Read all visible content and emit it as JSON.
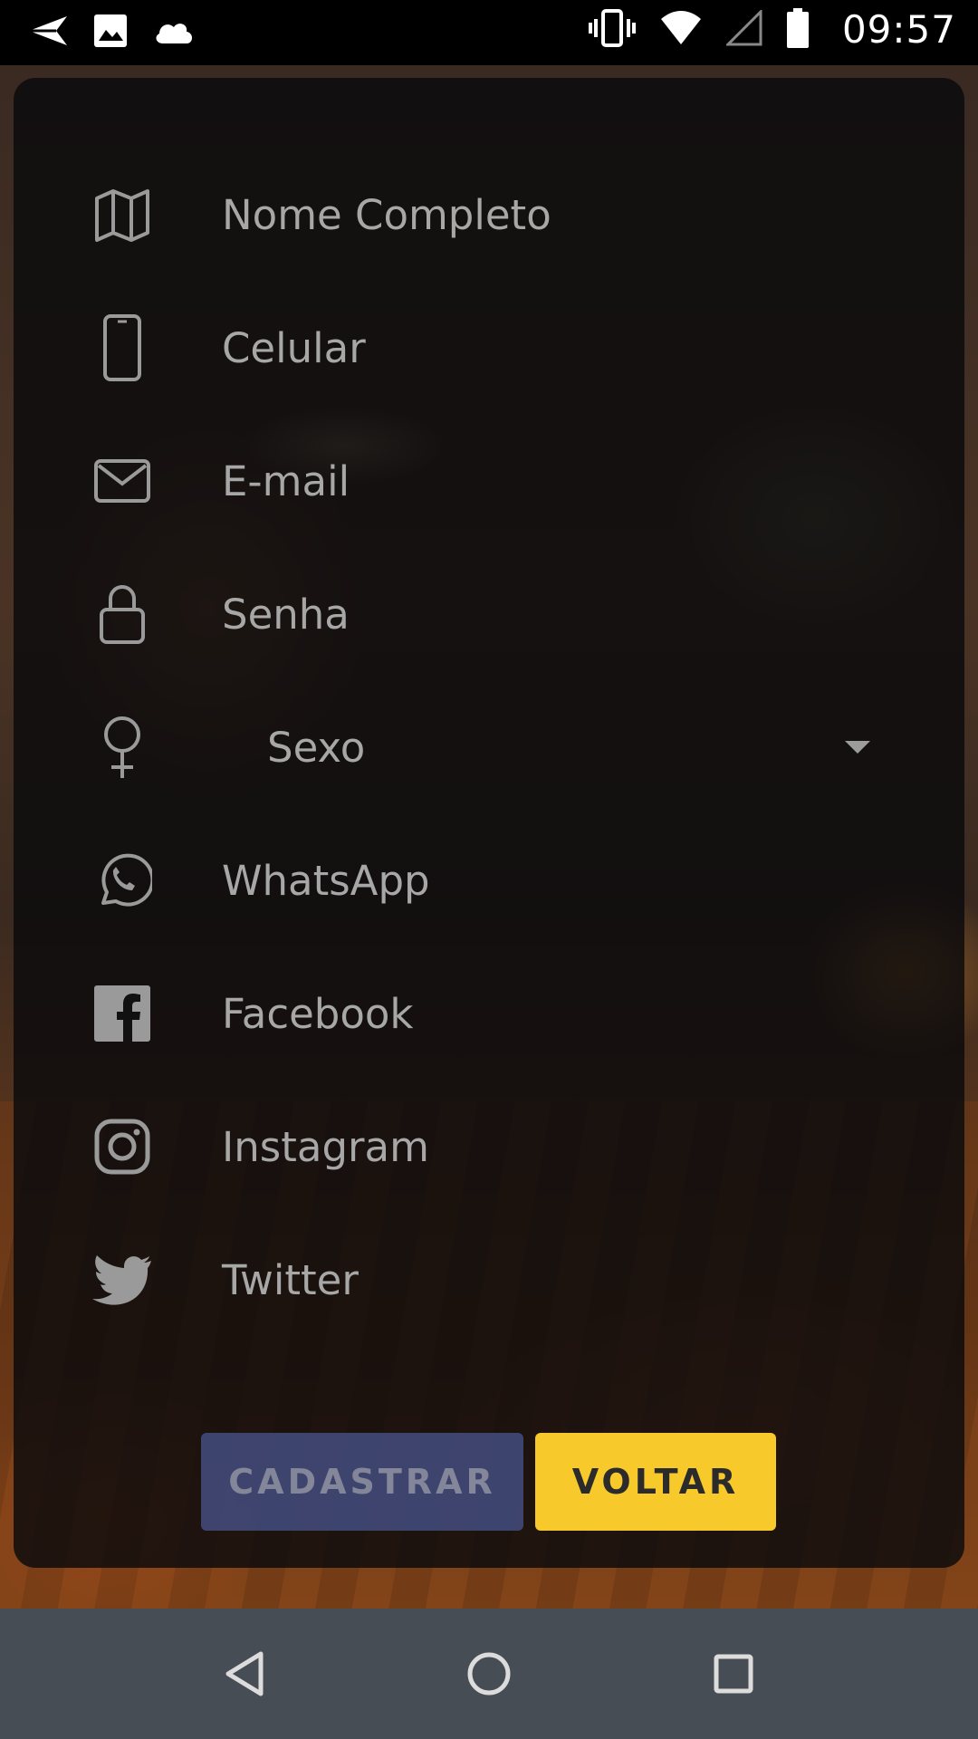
{
  "status_bar": {
    "time": "09:57",
    "icons": [
      "send-icon",
      "image-icon",
      "cloud-icon",
      "vibrate-icon",
      "wifi-icon",
      "cell-signal-icon",
      "battery-icon"
    ]
  },
  "form": {
    "fields": [
      {
        "icon": "map-icon",
        "placeholder": "Nome Completo"
      },
      {
        "icon": "phone-icon",
        "placeholder": "Celular"
      },
      {
        "icon": "email-icon",
        "placeholder": "E-mail"
      },
      {
        "icon": "lock-icon",
        "placeholder": "Senha"
      },
      {
        "icon": "female-icon",
        "placeholder": "Sexo"
      },
      {
        "icon": "whatsapp-icon",
        "placeholder": "WhatsApp"
      },
      {
        "icon": "facebook-icon",
        "placeholder": "Facebook"
      },
      {
        "icon": "instagram-icon",
        "placeholder": "Instagram"
      },
      {
        "icon": "twitter-icon",
        "placeholder": "Twitter"
      }
    ],
    "sexo_selected": "Sexo"
  },
  "buttons": {
    "cadastrar": "CADASTRAR",
    "voltar": "VOLTAR"
  },
  "colors": {
    "accent_yellow": "#f7c92b",
    "disabled_blue": "#5a6ebe",
    "placeholder_gray": "#a7a7a7",
    "nav_bar": "#474d55"
  },
  "nav_bar": {
    "buttons": [
      "back-icon",
      "home-icon",
      "recents-icon"
    ]
  }
}
